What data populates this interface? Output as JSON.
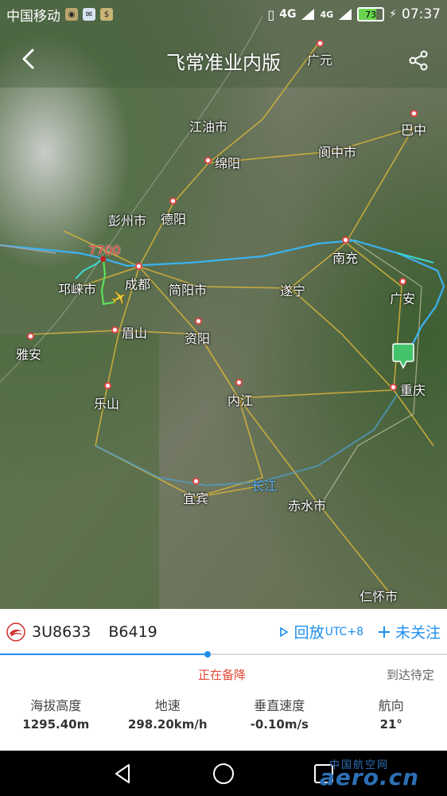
{
  "status_bar": {
    "carrier": "中国移动",
    "network": "4G",
    "network2": "4G",
    "battery": "73",
    "time": "07:37",
    "icons": [
      "location-pin-icon",
      "app-icon",
      "money-icon",
      "vibrate-icon",
      "signal-icon"
    ]
  },
  "header": {
    "title": "飞常准业内版",
    "back_icon": "back-chevron-icon",
    "share_icon": "share-icon"
  },
  "map": {
    "squawk": "7700",
    "river_label": "长江",
    "cities": [
      {
        "name": "广元"
      },
      {
        "name": "巴中"
      },
      {
        "name": "江油市"
      },
      {
        "name": "绵阳"
      },
      {
        "name": "阆中市"
      },
      {
        "name": "德阳"
      },
      {
        "name": "彭州市"
      },
      {
        "name": "成都"
      },
      {
        "name": "邛崃市"
      },
      {
        "name": "简阳市"
      },
      {
        "name": "南充"
      },
      {
        "name": "遂宁"
      },
      {
        "name": "广安"
      },
      {
        "name": "眉山"
      },
      {
        "name": "资阳"
      },
      {
        "name": "雅安"
      },
      {
        "name": "乐山"
      },
      {
        "name": "内江"
      },
      {
        "name": "重庆"
      },
      {
        "name": "宜宾"
      },
      {
        "name": "赤水市"
      },
      {
        "name": "仁怀市"
      }
    ],
    "colors": {
      "track_cyan": "#3fd8d0",
      "track_blue": "#2a8ee8",
      "track_green": "#5ee05a",
      "landing_marker": "#43c46b",
      "squawk": "#e23a3a"
    }
  },
  "flight": {
    "flight_no": "3U8633",
    "registration": "B6419",
    "replay_label": "回放",
    "replay_tz": "UTC+8",
    "follow_label": "未关注",
    "phase": "正在备降",
    "arrival_status": "到达待定",
    "progress": 0.465,
    "stats": [
      {
        "label": "海拔高度",
        "value": "1295.40m"
      },
      {
        "label": "地速",
        "value": "298.20km/h"
      },
      {
        "label": "垂直速度",
        "value": "-0.10m/s"
      },
      {
        "label": "航向",
        "value": "21°"
      }
    ]
  },
  "watermark": {
    "cn": "中国航空网",
    "en": "aero.cn"
  }
}
